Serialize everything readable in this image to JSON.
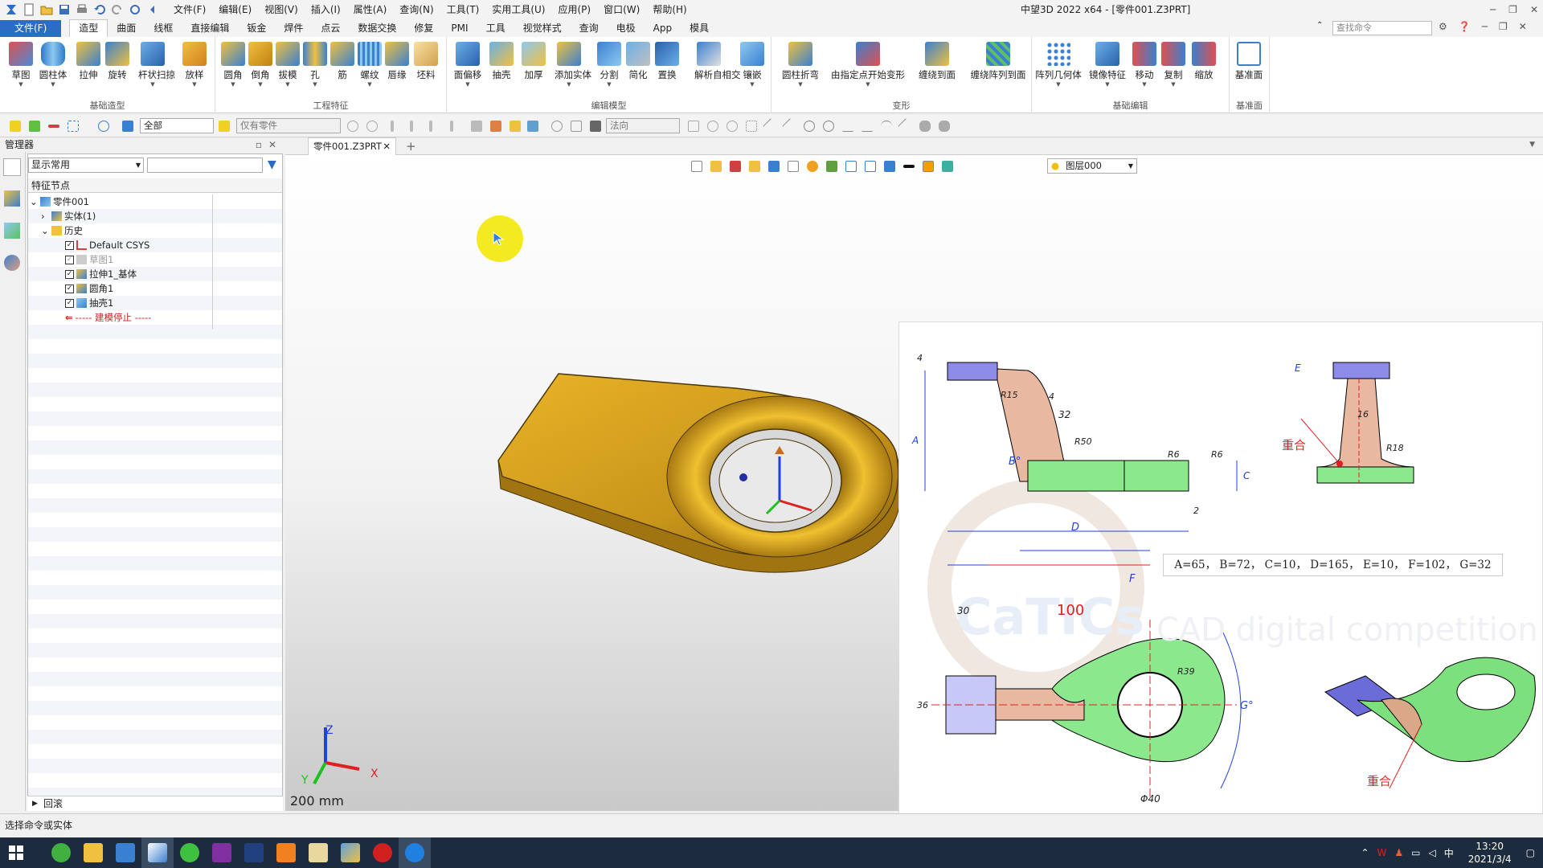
{
  "app": {
    "title": "中望3D 2022 x64 - [零件001.Z3PRT]"
  },
  "menu": [
    "文件(F)",
    "编辑(E)",
    "视图(V)",
    "插入(I)",
    "属性(A)",
    "查询(N)",
    "工具(T)",
    "实用工具(U)",
    "应用(P)",
    "窗口(W)",
    "帮助(H)"
  ],
  "ribbon_tabs": [
    "文件(F)",
    "造型",
    "曲面",
    "线框",
    "直接编辑",
    "钣金",
    "焊件",
    "点云",
    "数据交换",
    "修复",
    "PMI",
    "工具",
    "视觉样式",
    "查询",
    "电极",
    "App",
    "模具"
  ],
  "search_placeholder": "查找命令",
  "ribbon": {
    "groups": [
      {
        "label": "基础造型",
        "buttons": [
          "草图",
          "圆柱体",
          "拉伸",
          "旋转",
          "扫掠",
          "杆状扫掠",
          "放样"
        ]
      },
      {
        "label": "工程特征",
        "buttons": [
          "圆角",
          "倒角",
          "拔模",
          "孔",
          "筋",
          "螺纹",
          "唇缘",
          "坯料"
        ]
      },
      {
        "label": "编辑模型",
        "buttons": [
          "面偏移",
          "抽壳",
          "加厚",
          "添加实体",
          "分割",
          "简化",
          "置换",
          "解析自相交",
          "镶嵌"
        ]
      },
      {
        "label": "变形",
        "buttons": [
          "圆柱折弯",
          "由指定点开始变形",
          "缠绕到面",
          "缠绕阵列到面"
        ]
      },
      {
        "label": "基础编辑",
        "buttons": [
          "阵列几何体",
          "镜像特征",
          "移动",
          "复制",
          "缩放"
        ]
      },
      {
        "label": "基准面",
        "buttons": [
          "基准面"
        ]
      }
    ]
  },
  "toolbar": {
    "filter": "全部",
    "scope": "仅有零件",
    "direction": "法向"
  },
  "manager": {
    "title": "管理器",
    "display": "显示常用",
    "tree_header": "特征节点",
    "rollback": "回滚"
  },
  "tree": [
    {
      "label": "零件001",
      "level": 0,
      "expand": "⌄"
    },
    {
      "label": "实体(1)",
      "level": 1,
      "expand": "›"
    },
    {
      "label": "历史",
      "level": 1,
      "expand": "⌄"
    },
    {
      "label": "Default CSYS",
      "level": 2,
      "check": true
    },
    {
      "label": "草图1",
      "level": 2,
      "check": true,
      "dim": true
    },
    {
      "label": "拉伸1_基体",
      "level": 2,
      "check": true
    },
    {
      "label": "圆角1",
      "level": 2,
      "check": true
    },
    {
      "label": "抽壳1",
      "level": 2,
      "check": true
    },
    {
      "label": "----- 建模停止 -----",
      "level": 2,
      "stop": true
    }
  ],
  "doc_tab": "零件001.Z3PRT",
  "layer": "图层000",
  "scale": "200 mm",
  "axes": {
    "x": "X",
    "y": "Y",
    "z": "Z"
  },
  "drawing": {
    "dims_text": "A=65， B=72， C=10， D=165， E=10， F=102， G=32",
    "labels": {
      "A": "A",
      "B": "B°",
      "C": "C",
      "D": "D",
      "E": "E",
      "F": "F",
      "G": "G°",
      "r15": "R15",
      "four_a": "4",
      "four_b": "4",
      "r50": "R50",
      "thirtytwo": "32",
      "r6a": "R6",
      "r6b": "R6",
      "two": "2",
      "sixteen": "16",
      "r18": "R18",
      "chonghe1": "重合",
      "chonghe2": "重合",
      "thirty": "30",
      "hundred": "100",
      "r39": "R39",
      "thirtysix": "36",
      "phi40": "Φ40"
    },
    "watermark": "CaTICs",
    "watermark_sub": "CAD digital competition"
  },
  "status": "选择命令或实体",
  "clock": {
    "time": "13:20",
    "date": "2021/3/4"
  },
  "tray_lang": "中",
  "colors": {
    "accent": "#2b6cc4",
    "part": "#d9a514",
    "green": "#7ee27e",
    "blue_block": "#8e8ef0"
  }
}
